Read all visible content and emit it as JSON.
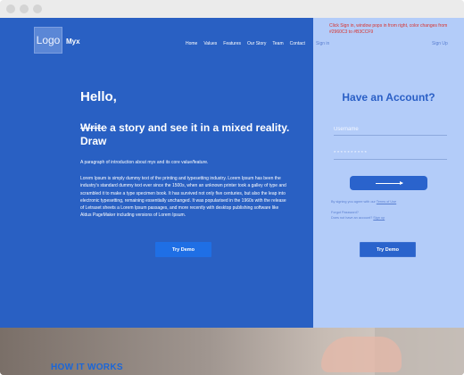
{
  "brand": {
    "logo_text": "Logo",
    "name": "Myx"
  },
  "nav": {
    "items": [
      "Home",
      "Values",
      "Features",
      "Our Story",
      "Team",
      "Contact"
    ]
  },
  "annotation_note": "Click Sign in, window pops in from right, color changes from #2960C3 to #B3CCF9",
  "auth_links": {
    "sign_in": "Sign in",
    "sign_up": "Sign Up"
  },
  "hero": {
    "greeting": "Hello,",
    "headline_strike": "Write",
    "headline_rest": " a story and see it in a mixed reality. Draw",
    "intro": "A paragraph of introduction about myx and its core value/feature.",
    "body": "Lorem Ipsum is simply dummy text of the printing and typesetting industry. Lorem Ipsum has been the industry's standard dummy text ever since the 1500s, when an unknown printer took a galley of type and scrambled it to make a type specimen book. It has survived not only five centuries, but also the leap into electronic typesetting, remaining essentially unchanged. It was popularised in the 1960s with the release of Letraset sheets a Lorem Ipsum passages, and more recently with desktop publishing software like Aldus PageMaker including versions of Lorem Ipsum.",
    "demo_label": "Try Demo"
  },
  "account": {
    "title": "Have an Account?",
    "username_placeholder": "Username",
    "password_value": "**********",
    "terms_prefix": "By signing you agree with our ",
    "terms_link": "Terms of Use",
    "forgot_password": "Forgot Password?",
    "no_account_prefix": "Does not have an account? ",
    "no_account_link": "Sign up",
    "demo_label": "Try Demo"
  },
  "how_it_works": {
    "title": "HOW IT WORKS"
  },
  "colors": {
    "hero_blue": "#2960c3",
    "panel_light": "#b3ccf9",
    "button_blue": "#1f6fe5",
    "note_red": "#d9332e"
  }
}
